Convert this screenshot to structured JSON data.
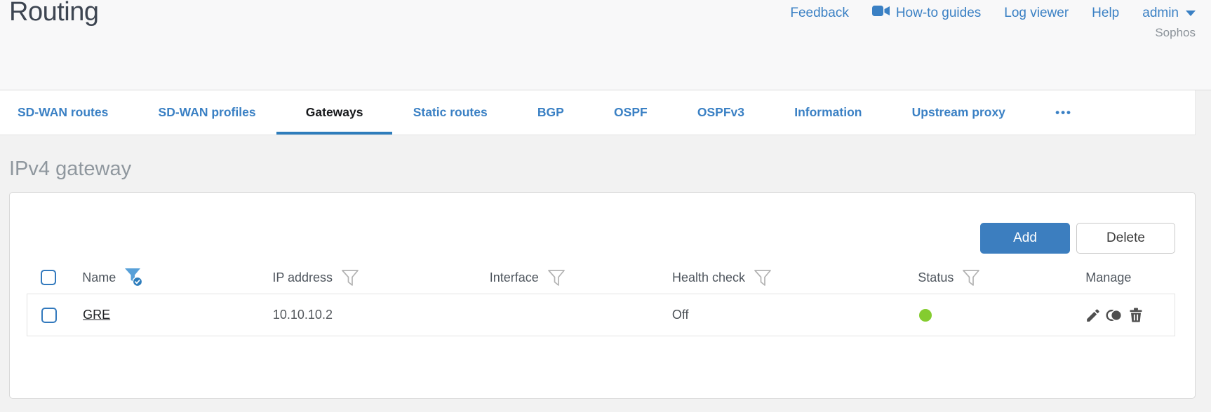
{
  "page": {
    "title": "Routing",
    "brand": "Sophos"
  },
  "topnav": {
    "links": [
      {
        "label": "Feedback"
      },
      {
        "label": "How-to guides",
        "icon": "video-camera-icon"
      },
      {
        "label": "Log viewer"
      },
      {
        "label": "Help"
      },
      {
        "label": "admin",
        "icon": "caret-down-icon"
      }
    ]
  },
  "tabs": {
    "items": [
      {
        "label": "SD-WAN routes",
        "active": false
      },
      {
        "label": "SD-WAN profiles",
        "active": false
      },
      {
        "label": "Gateways",
        "active": true
      },
      {
        "label": "Static routes",
        "active": false
      },
      {
        "label": "BGP",
        "active": false
      },
      {
        "label": "OSPF",
        "active": false
      },
      {
        "label": "OSPFv3",
        "active": false
      },
      {
        "label": "Information",
        "active": false
      },
      {
        "label": "Upstream proxy",
        "active": false
      },
      {
        "label": "•••",
        "active": false,
        "icon": "more-tabs-ellipsis-icon"
      }
    ]
  },
  "section": {
    "heading": "IPv4 gateway"
  },
  "toolbar": {
    "add_label": "Add",
    "delete_label": "Delete"
  },
  "table": {
    "select_all_checked": false,
    "columns": [
      {
        "label": "Name",
        "filter": "active"
      },
      {
        "label": "IP address",
        "filter": "inactive"
      },
      {
        "label": "Interface",
        "filter": "inactive"
      },
      {
        "label": "Health check",
        "filter": "inactive"
      },
      {
        "label": "Status",
        "filter": "inactive"
      },
      {
        "label": "Manage",
        "filter": "none"
      }
    ],
    "rows": [
      {
        "checked": false,
        "name": "GRE",
        "ip_address": "10.10.10.2",
        "interface": "",
        "health_check": "Off",
        "status": "up",
        "manage_icons": [
          "edit-icon",
          "clone-icon",
          "delete-icon"
        ]
      }
    ]
  },
  "colors": {
    "accent_blue": "#3a80c4",
    "add_button_blue": "#3c7ebf",
    "active_tab_underline": "#2e7dbc",
    "status_up_green": "#84cc2f"
  }
}
